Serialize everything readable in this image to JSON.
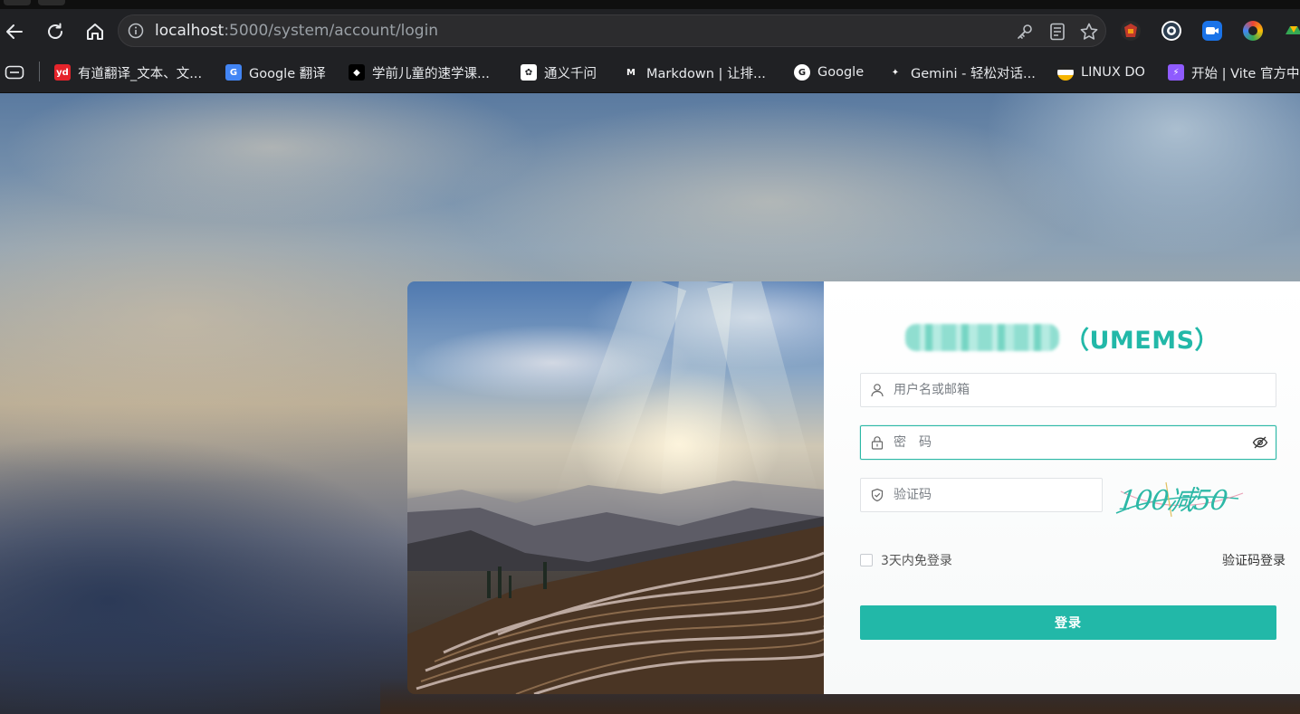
{
  "browser": {
    "url_host": "localhost",
    "url_rest": ":5000/system/account/login",
    "bookmarks": [
      {
        "label": "有道翻译_文本、文...",
        "icon": "youdao-icon",
        "color": "#e5242b",
        "fav_text": "yd"
      },
      {
        "label": "Google 翻译",
        "icon": "google-translate-icon",
        "color": "#4285f4",
        "fav_text": "G"
      },
      {
        "label": "学前儿童的速学课...",
        "icon": "course-icon",
        "color": "#000000",
        "fav_text": "◆"
      },
      {
        "label": "通义千问",
        "icon": "tongyi-icon",
        "color": "#ffffff",
        "fav_text": "✿"
      },
      {
        "label": "Markdown | 让排...",
        "icon": "markdown-icon",
        "color": "#202124",
        "fav_text": "M"
      },
      {
        "label": "Google",
        "icon": "google-icon",
        "color": "#ffffff",
        "fav_text": "G"
      },
      {
        "label": "Gemini - 轻松对话...",
        "icon": "gemini-icon",
        "color": "#202124",
        "fav_text": "✦"
      },
      {
        "label": "LINUX DO",
        "icon": "linuxdo-icon",
        "color": "#f5b400",
        "fav_text": ""
      },
      {
        "label": "开始 | Vite 官方中...",
        "icon": "vite-icon",
        "color": "#8f5bff",
        "fav_text": "⚡"
      }
    ]
  },
  "login": {
    "title_suffix": "（UMEMS）",
    "username_placeholder": "用户名或邮箱",
    "password_placeholder": "密　码",
    "captcha_placeholder": "验证码",
    "captcha_text": "100减50",
    "remember_label": "3天内免登录",
    "sms_login_label": "验证码登录",
    "login_button": "登录"
  },
  "colors": {
    "accent": "#22b8a8"
  }
}
